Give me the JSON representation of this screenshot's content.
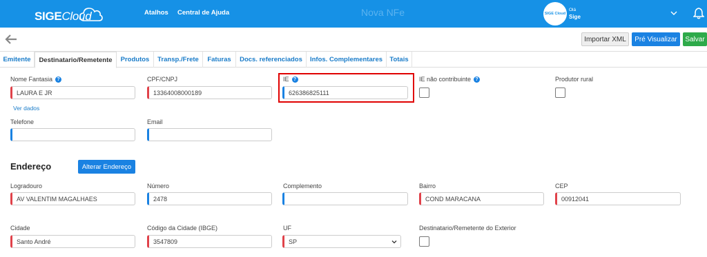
{
  "brand": {
    "logo_main": "SIGE",
    "logo_accent": "Cloud"
  },
  "nav": {
    "atalhos": "Atalhos",
    "ajuda": "Central de Ajuda"
  },
  "page_title": "Nova NFe",
  "user": {
    "avatar": "SIGE Cloud",
    "hello": "Olá",
    "name": "Sige"
  },
  "actions": {
    "import": "Importar XML",
    "preview": "Pré Visualizar",
    "save": "Salvar"
  },
  "tabs": [
    {
      "label": "Emitente"
    },
    {
      "label": "Destinatario/Remetente"
    },
    {
      "label": "Produtos"
    },
    {
      "label": "Transp./Frete"
    },
    {
      "label": "Faturas"
    },
    {
      "label": "Docs. referenciados"
    },
    {
      "label": "Infos. Complementares"
    },
    {
      "label": "Totais"
    }
  ],
  "form": {
    "nome_fantasia": {
      "label": "Nome Fantasia",
      "value": "LAURA E JR"
    },
    "cpf_cnpj": {
      "label": "CPF/CNPJ",
      "value": "13364008000189"
    },
    "ie": {
      "label": "IE",
      "value": "626386825111"
    },
    "ie_nao_contribuinte": {
      "label": "IE não contribuinte"
    },
    "produtor_rural": {
      "label": "Produtor rural"
    },
    "ver_dados": "Ver dados",
    "telefone": {
      "label": "Telefone",
      "value": ""
    },
    "email": {
      "label": "Email",
      "value": ""
    }
  },
  "endereco": {
    "title": "Endereço",
    "alterar": "Alterar Endereço",
    "logradouro": {
      "label": "Logradouro",
      "value": "AV VALENTIM MAGALHAES"
    },
    "numero": {
      "label": "Número",
      "value": "2478"
    },
    "complemento": {
      "label": "Complemento",
      "value": ""
    },
    "bairro": {
      "label": "Bairro",
      "value": "COND MARACANA"
    },
    "cep": {
      "label": "CEP",
      "value": "00912041"
    },
    "cidade": {
      "label": "Cidade",
      "value": "Santo André"
    },
    "codigo_cidade": {
      "label": "Código da Cidade (IBGE)",
      "value": "3547809"
    },
    "uf": {
      "label": "UF",
      "value": "SP"
    },
    "exterior": {
      "label": "Destinatario/Remetente do Exterior"
    }
  },
  "colors": {
    "topbar": "#1691e6",
    "required": "#e0424a",
    "optional": "#1a82e2",
    "save": "#2eaa4a",
    "highlight": "#e00000"
  }
}
